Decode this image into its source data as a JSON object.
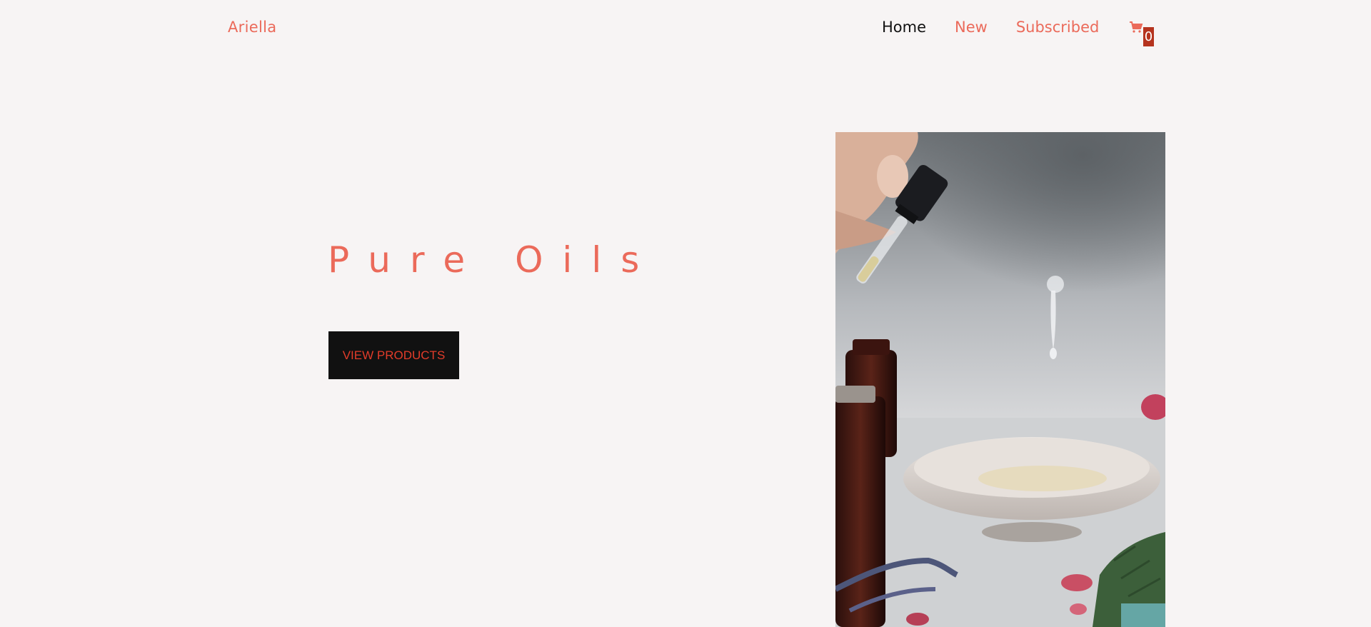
{
  "brand": {
    "name": "Ariella"
  },
  "nav": {
    "items": [
      {
        "label": "Home",
        "active": true
      },
      {
        "label": "New",
        "active": false
      },
      {
        "label": "Subscribed",
        "active": false
      }
    ],
    "cart": {
      "icon": "cart-icon",
      "count": "0"
    }
  },
  "hero": {
    "title": "Pure Oils",
    "cta_label": "VIEW PRODUCTS",
    "image_icon": "essential-oil-dropper-photo"
  },
  "colors": {
    "background": "#f7f4f4",
    "accent": "#eb6a5a",
    "nav_active": "#111111",
    "button_bg": "#111111",
    "button_text": "#e23c2a",
    "badge": "#b5331e"
  }
}
